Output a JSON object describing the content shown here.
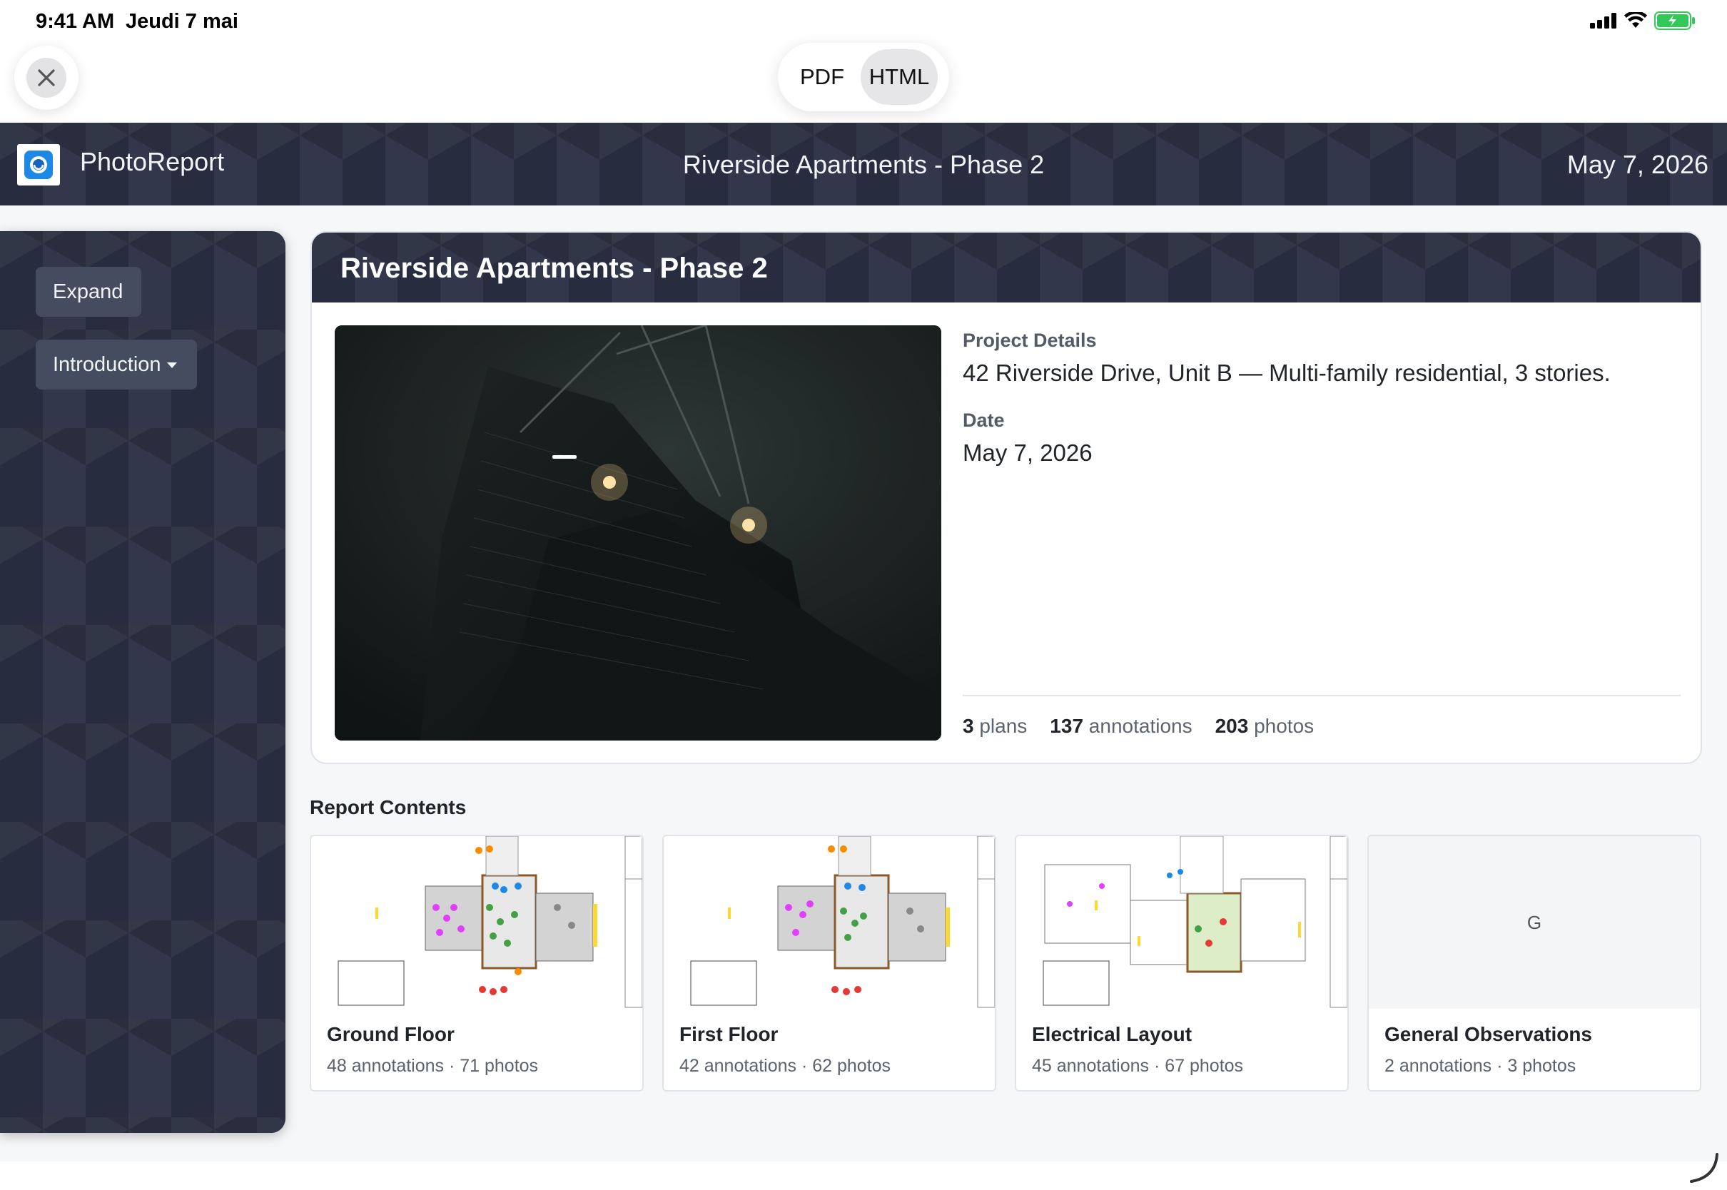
{
  "status": {
    "time": "9:41 AM",
    "date": "Jeudi 7 mai"
  },
  "toolbar": {
    "pdf_label": "PDF",
    "html_label": "HTML"
  },
  "app": {
    "name": "PhotoReport",
    "title": "Riverside Apartments - Phase 2",
    "date": "May 7, 2026"
  },
  "sidebar": {
    "expand_label": "Expand",
    "section_label": "Introduction"
  },
  "project": {
    "title": "Riverside Apartments - Phase 2",
    "details_label": "Project Details",
    "details_value": "42 Riverside Drive, Unit B — Multi-family residential, 3 stories.",
    "date_label": "Date",
    "date_value": "May 7, 2026",
    "stats": {
      "plans_count": "3",
      "plans_label": "plans",
      "annotations_count": "137",
      "annotations_label": "annotations",
      "photos_count": "203",
      "photos_label": "photos"
    }
  },
  "report_contents": {
    "title": "Report Contents",
    "items": [
      {
        "name": "Ground Floor",
        "meta": "48 annotations · 71 photos"
      },
      {
        "name": "First Floor",
        "meta": "42 annotations · 62 photos"
      },
      {
        "name": "Electrical Layout",
        "meta": "45 annotations · 67 photos"
      },
      {
        "name": "General Observations",
        "meta": "2 annotations · 3 photos",
        "placeholder": "G"
      }
    ]
  },
  "colors": {
    "header_dark": "#2b3145",
    "card_border": "#e1e3e8",
    "battery": "#34c759"
  },
  "icons": [
    "close-icon",
    "signal-icon",
    "wifi-icon",
    "battery-icon",
    "app-logo-icon",
    "caret-down-icon",
    "resize-handle-icon"
  ]
}
